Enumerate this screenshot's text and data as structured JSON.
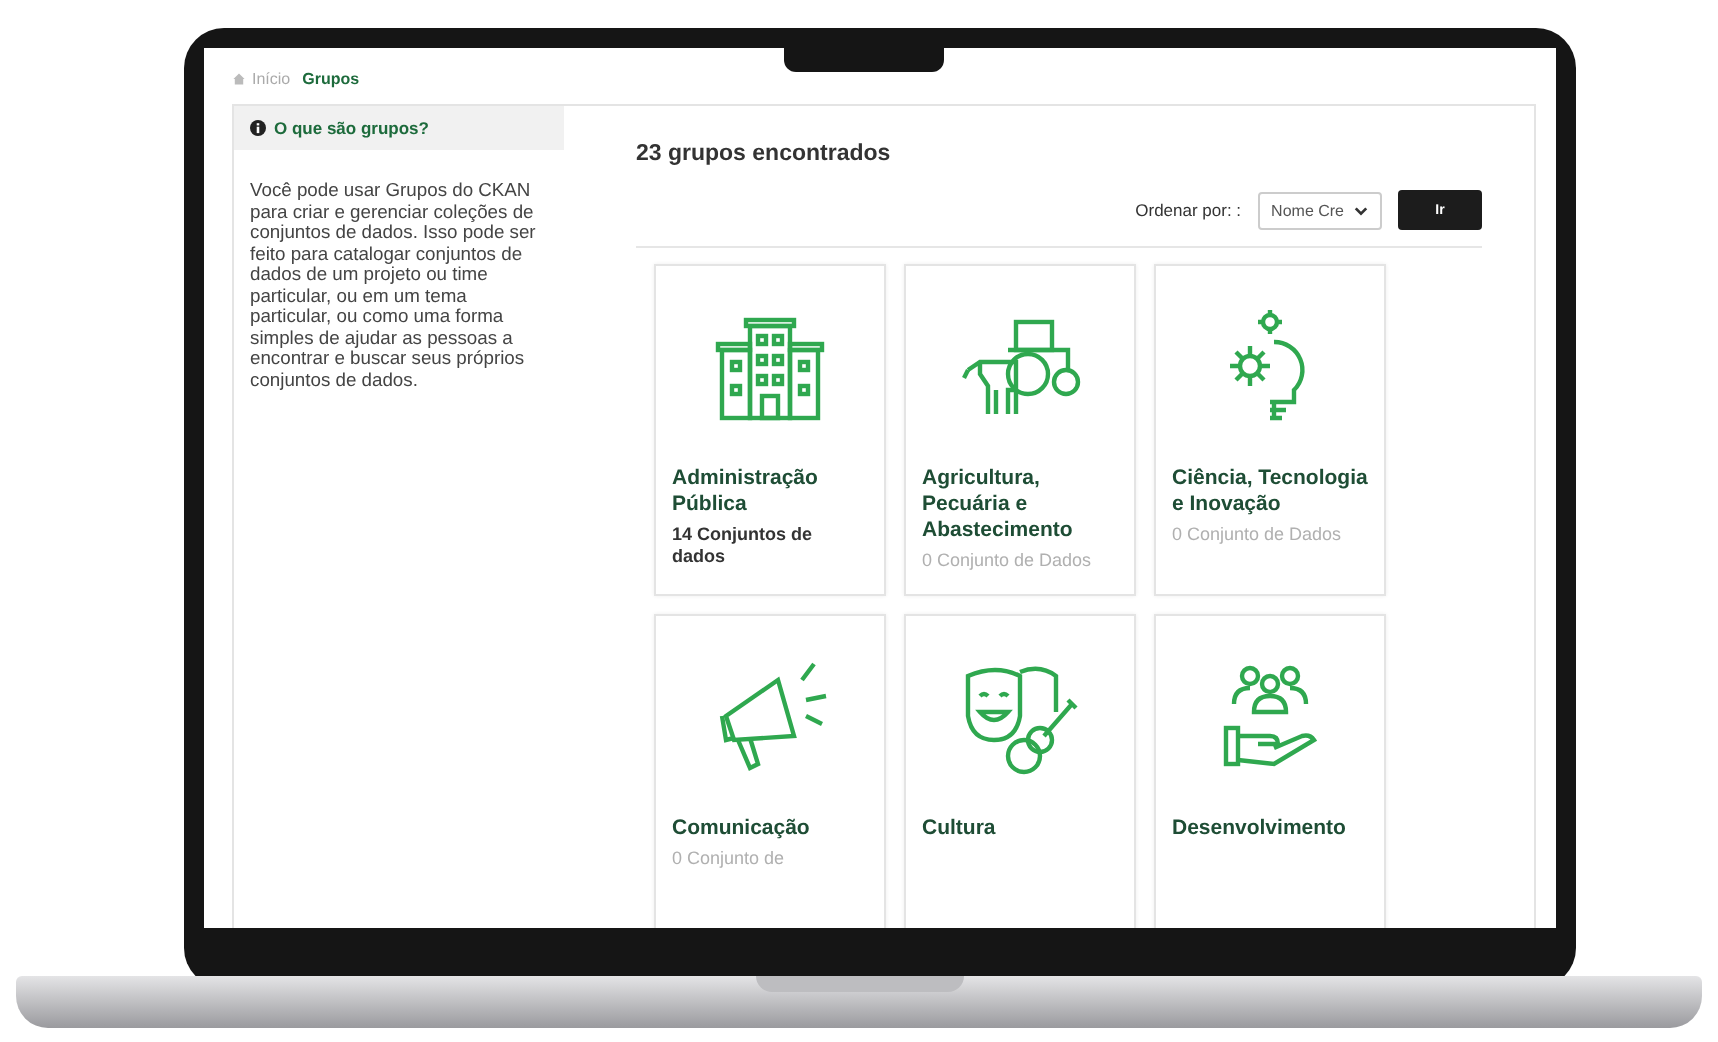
{
  "breadcrumb": [
    {
      "label": "Início",
      "selected": false
    },
    {
      "label": "Grupos",
      "selected": true
    }
  ],
  "sidebar": {
    "heading": "O que são grupos?",
    "text": "Você pode usar Grupos do CKAN para criar e gerenciar coleções de conjuntos de dados. Isso pode ser feito para catalogar conjuntos de dados de um projeto ou time particular, ou em um tema particular, ou como uma forma simples de ajudar as pessoas a encontrar e buscar seus próprios conjuntos de dados."
  },
  "results": {
    "title": "23 grupos encontrados",
    "sort_label": "Ordenar por: :",
    "sort_value": "Nome Cre",
    "submit": "Ir"
  },
  "groups": [
    {
      "title": "Administração Pública",
      "count": "14 Conjuntos de dados",
      "empty": false
    },
    {
      "title": "Agricultura, Pecuária e Abastecimento",
      "count": "0 Conjunto de Dados",
      "empty": true
    },
    {
      "title": "Ciência, Tecnologia e Inovação",
      "count": "0 Conjunto de Dados",
      "empty": true
    },
    {
      "title": "Comunicação",
      "count": "0 Conjunto de",
      "empty": true
    },
    {
      "title": "Cultura"
    },
    {
      "title": "Desenvolvimento"
    }
  ]
}
